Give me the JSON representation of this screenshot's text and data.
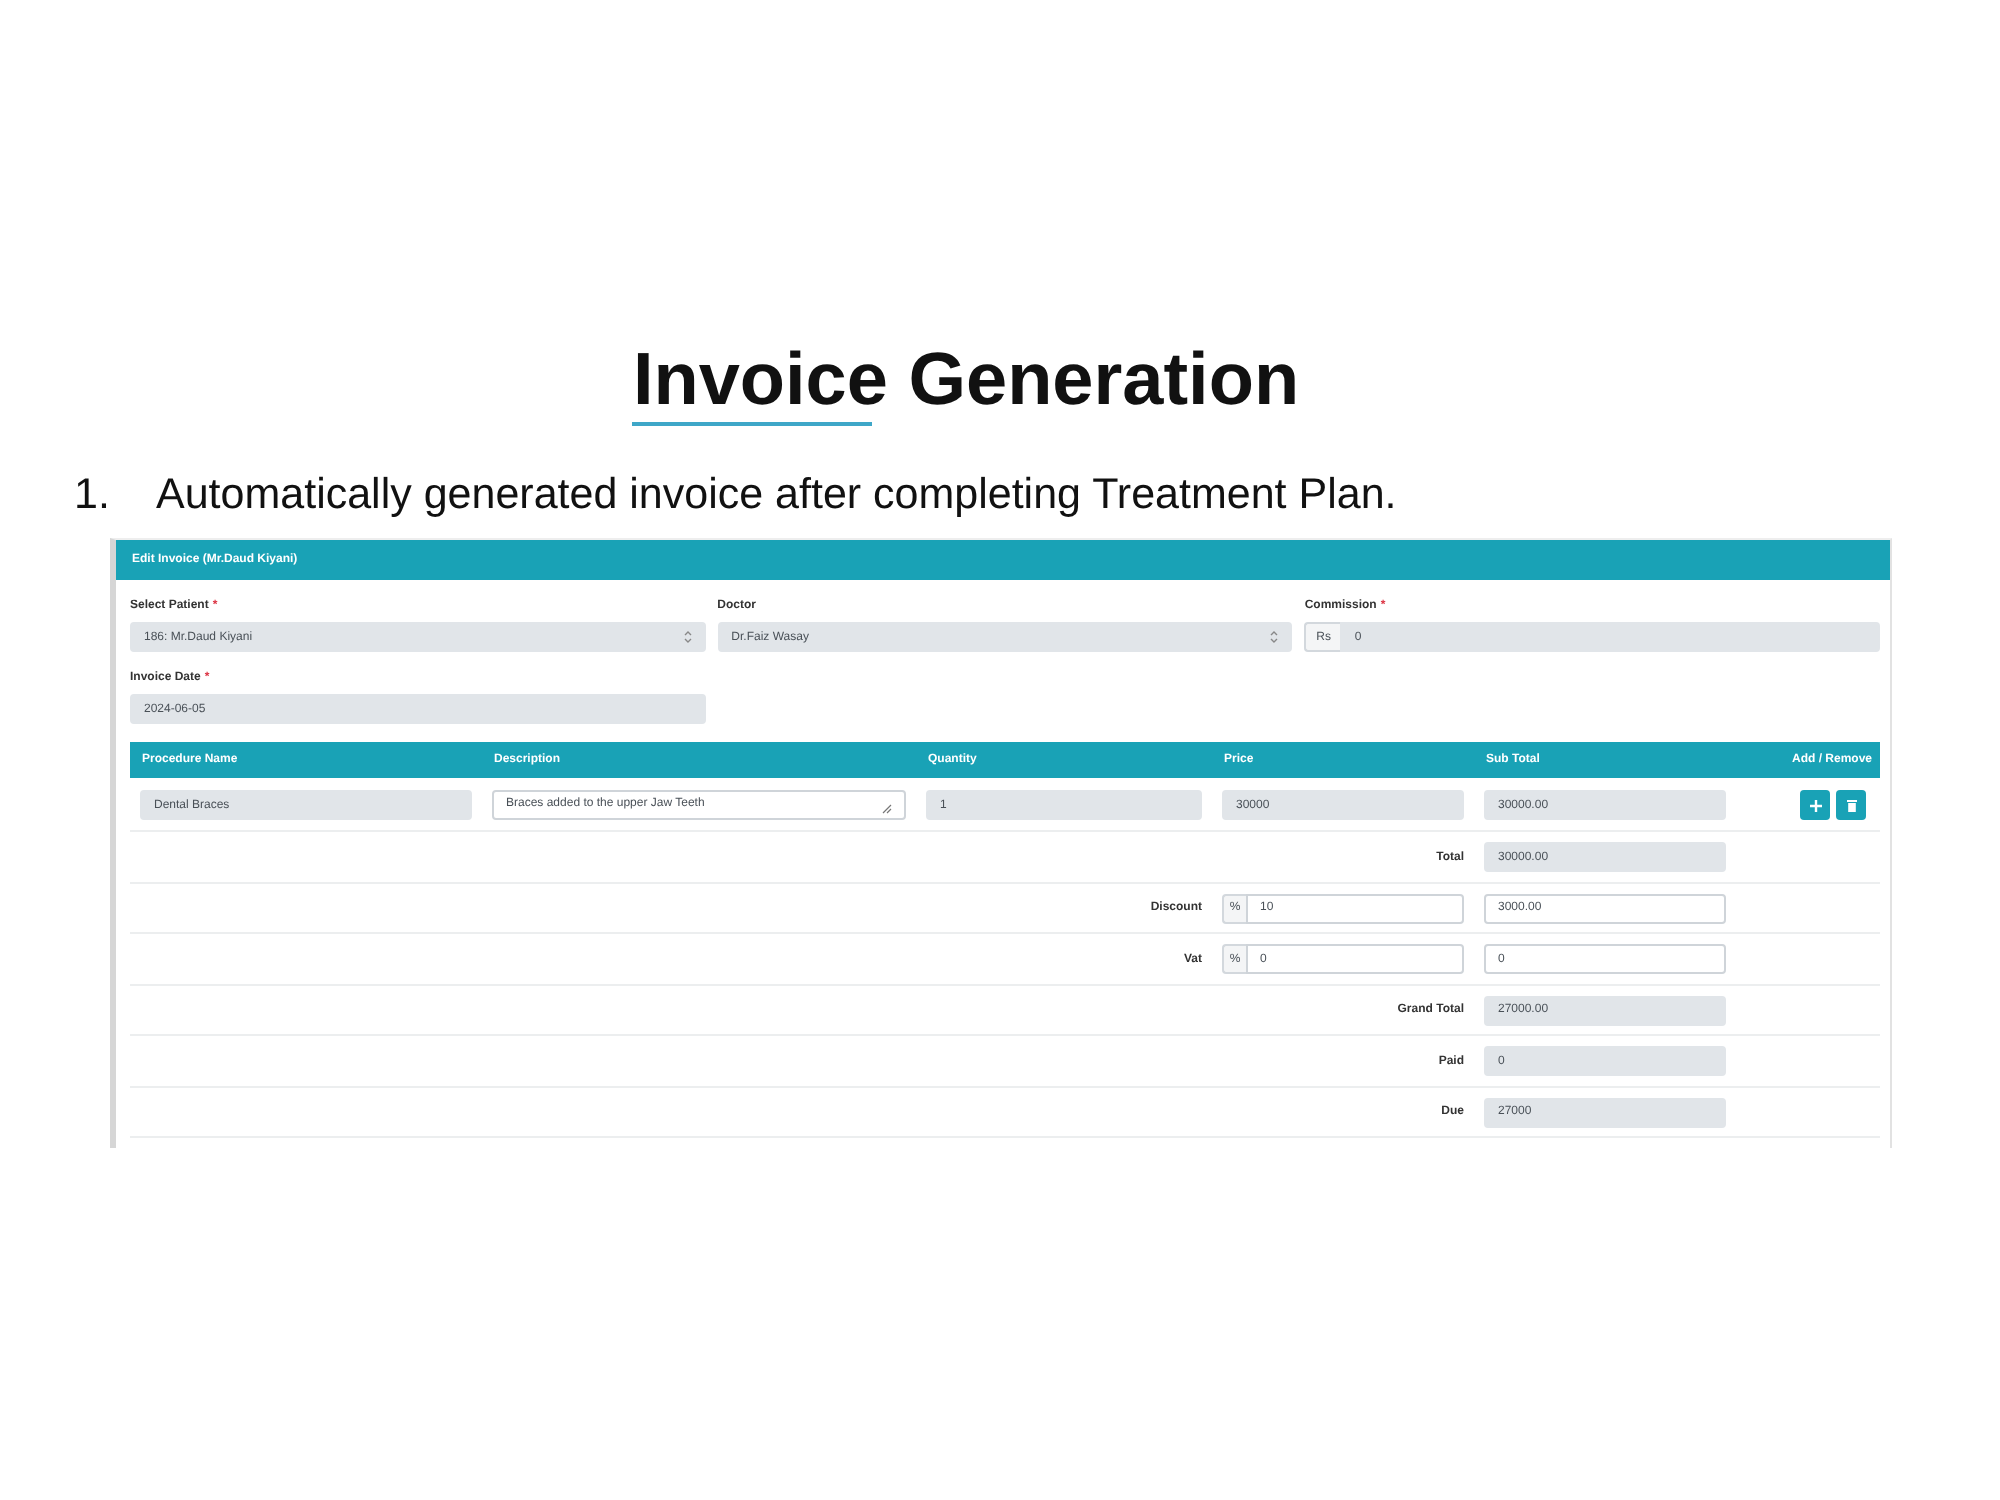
{
  "slide": {
    "title": "Invoice Generation",
    "list": [
      {
        "number": "1.",
        "text": "Automatically generated invoice after completing Treatment Plan."
      }
    ]
  },
  "form": {
    "title": "Edit Invoice (Mr.Daud Kiyani)",
    "fields": [
      {
        "kind": "select",
        "label": "Select Patient",
        "required_mark": "*",
        "value": "186: Mr.Daud Kiyani",
        "readonly": true
      },
      {
        "kind": "select",
        "label": "Doctor",
        "value": "Dr.Faiz Wasay",
        "readonly": true
      },
      {
        "kind": "prefixed",
        "label": "Commission",
        "required_mark": "*",
        "prefix": "Rs",
        "value": "0",
        "readonly": true
      },
      {
        "kind": "input",
        "label": "Invoice Date",
        "required_mark": "*",
        "value": "2024-06-05",
        "readonly": true
      }
    ],
    "table": {
      "columns": [
        "Procedure Name",
        "Description",
        "Quantity",
        "Price",
        "Sub Total",
        "Add / Remove"
      ],
      "rows": [
        {
          "cells": [
            {
              "kind": "input",
              "value": "Dental Braces",
              "readonly": true
            },
            {
              "kind": "textarea",
              "value": "Braces added to the upper Jaw Teeth",
              "readonly": false
            },
            {
              "kind": "input",
              "value": "1",
              "readonly": true
            },
            {
              "kind": "input",
              "value": "30000",
              "readonly": true
            },
            {
              "kind": "input",
              "value": "30000.00",
              "readonly": true
            }
          ],
          "actions": [
            {
              "kind": "add"
            },
            {
              "kind": "remove"
            }
          ]
        }
      ]
    },
    "summary": [
      {
        "kind": "amount",
        "label": "Total",
        "amount": {
          "value": "30000.00",
          "readonly": true
        }
      },
      {
        "kind": "percent",
        "label": "Discount",
        "unit": "%",
        "rate": {
          "value": "10",
          "readonly": false
        },
        "amount": {
          "value": "3000.00",
          "readonly": false
        }
      },
      {
        "kind": "percent",
        "label": "Vat",
        "unit": "%",
        "rate": {
          "value": "0",
          "readonly": false
        },
        "amount": {
          "value": "0",
          "readonly": false
        }
      },
      {
        "kind": "amount",
        "label": "Grand Total",
        "amount": {
          "value": "27000.00",
          "readonly": true
        }
      },
      {
        "kind": "amount",
        "label": "Paid",
        "amount": {
          "value": "0",
          "readonly": true
        }
      },
      {
        "kind": "amount",
        "label": "Due",
        "amount": {
          "value": "27000",
          "readonly": true
        }
      }
    ]
  }
}
